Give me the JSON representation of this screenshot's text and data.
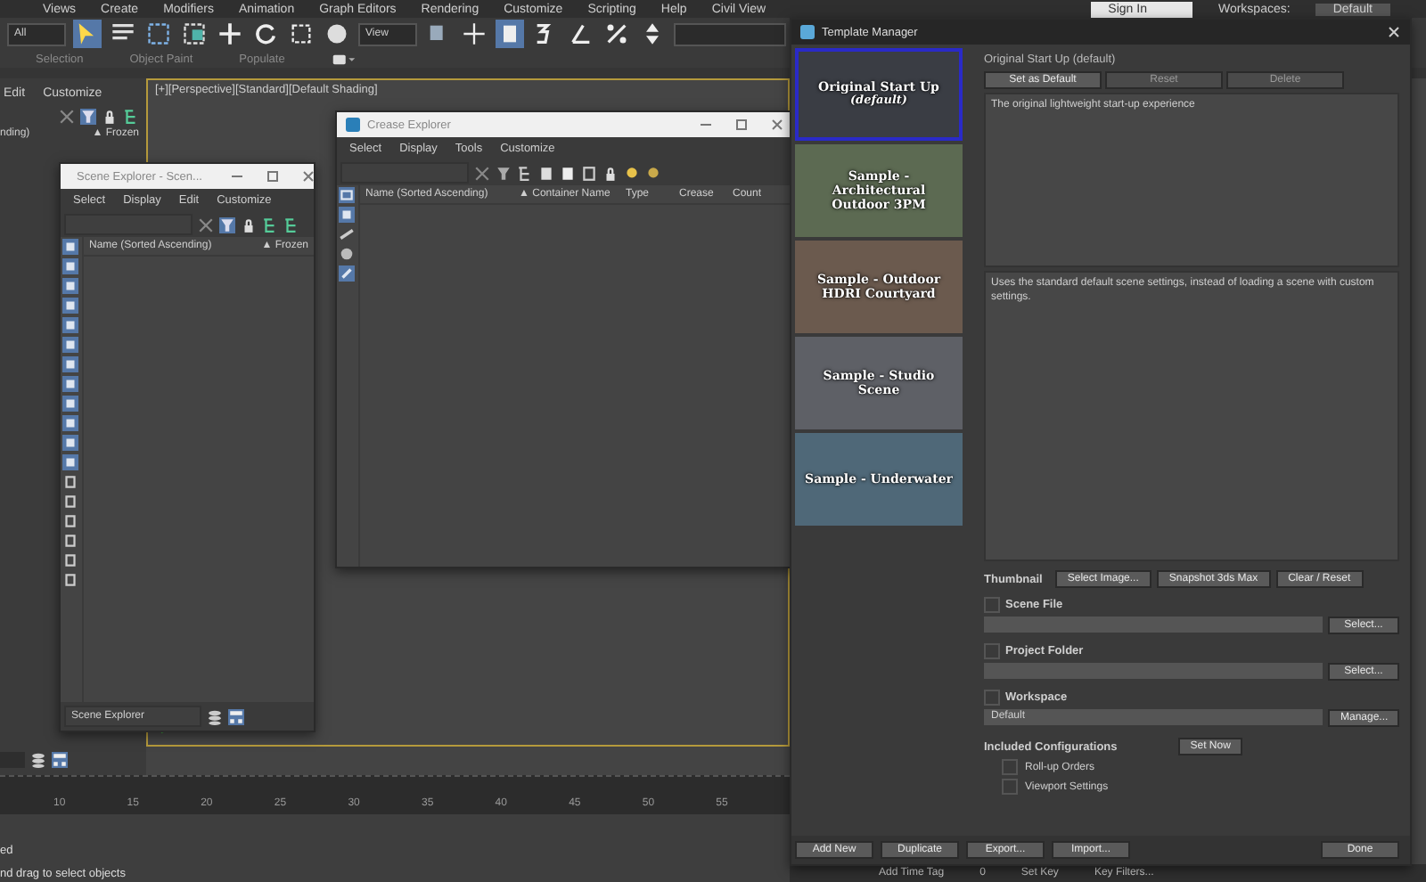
{
  "menu_bar": {
    "items": [
      "Views",
      "Create",
      "Modifiers",
      "Animation",
      "Graph Editors",
      "Rendering",
      "Customize",
      "Scripting",
      "Help",
      "Civil View"
    ],
    "sign_in": "Sign In",
    "workspaces_label": "Workspaces:",
    "workspace": "Default"
  },
  "toolbar": {
    "selection_filter": "All",
    "reference_coordinate": "View"
  },
  "ribbon_tabs": [
    "Selection",
    "Object Paint",
    "Populate"
  ],
  "side_panel": {
    "menu": [
      "Edit",
      "Customize"
    ],
    "columns": [
      "nding)",
      "▲ Frozen"
    ]
  },
  "viewport": {
    "label": "[+][Perspective][Standard][Default Shading]"
  },
  "timeline": {
    "ticks": [
      "10",
      "15",
      "20",
      "25",
      "30",
      "35",
      "40",
      "45",
      "50",
      "55"
    ]
  },
  "status_bar": [
    "ed",
    "nd drag to select objects"
  ],
  "bottom_bar": [
    "Add Time Tag",
    "0",
    "Set Key",
    "Key Filters..."
  ],
  "scene_explorer": {
    "title": "Scene Explorer - Scen...",
    "menu": [
      "Select",
      "Display",
      "Edit",
      "Customize"
    ],
    "columns": [
      "Name (Sorted Ascending)",
      "▲ Frozen"
    ],
    "footer": "Scene Explorer"
  },
  "crease_explorer": {
    "title": "Crease Explorer",
    "menu": [
      "Select",
      "Display",
      "Tools",
      "Customize"
    ],
    "columns": [
      "Name (Sorted Ascending)",
      "▲ Container Name",
      "Type",
      "Crease",
      "Count"
    ]
  },
  "template_manager": {
    "title": "Template Manager",
    "templates": [
      {
        "title": "Original Start Up",
        "subtitle": "(default)",
        "selected": true
      },
      {
        "title": "Sample - Architectural Outdoor 3PM",
        "selected": false
      },
      {
        "title": "Sample - Outdoor HDRI Courtyard",
        "selected": false
      },
      {
        "title": "Sample - Studio Scene",
        "selected": false
      },
      {
        "title": "Sample - Underwater",
        "selected": false
      }
    ],
    "heading": "Original Start Up (default)",
    "actions": [
      {
        "label": "Set as Default",
        "disabled": false
      },
      {
        "label": "Reset",
        "disabled": true
      },
      {
        "label": "Delete",
        "disabled": true
      }
    ],
    "description": "The original lightweight start-up experience",
    "details": "Uses the standard default scene settings, instead of loading a scene with custom settings.",
    "thumbnail": {
      "label": "Thumbnail",
      "buttons": [
        "Select Image...",
        "Snapshot 3ds Max",
        "Clear / Reset"
      ]
    },
    "sections": [
      {
        "label": "Scene File",
        "checked": false,
        "button": "Select..."
      },
      {
        "label": "Project Folder",
        "checked": false,
        "button": "Select..."
      },
      {
        "label": "Workspace",
        "checked": false,
        "value": "Default",
        "button": "Manage..."
      }
    ],
    "configurations": {
      "label": "Included Configurations",
      "button": "Set Now",
      "options": [
        {
          "label": "Roll-up Orders",
          "checked": false
        },
        {
          "label": "Viewport Settings",
          "checked": false
        }
      ]
    },
    "footer_buttons": [
      "Add New",
      "Duplicate",
      "Export...",
      "Import...",
      "Done"
    ]
  }
}
